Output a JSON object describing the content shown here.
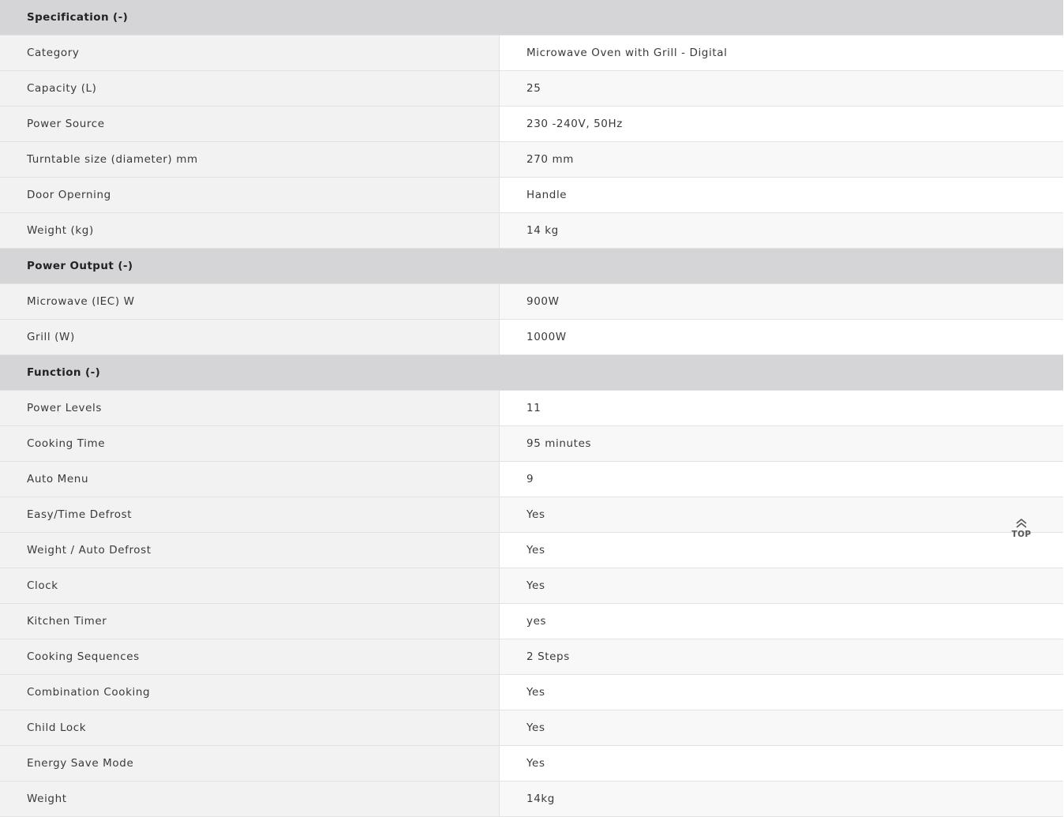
{
  "sections": [
    {
      "title": "Specification (-)",
      "rows": [
        {
          "label": "Category",
          "value": "Microwave Oven with Grill - Digital"
        },
        {
          "label": "Capacity (L)",
          "value": "25"
        },
        {
          "label": "Power Source",
          "value": "230 -240V, 50Hz"
        },
        {
          "label": "Turntable size (diameter) mm",
          "value": "270 mm"
        },
        {
          "label": "Door Operning",
          "value": "Handle"
        },
        {
          "label": "Weight (kg)",
          "value": "14 kg"
        }
      ]
    },
    {
      "title": "Power Output (-)",
      "rows": [
        {
          "label": "Microwave (IEC) W",
          "value": "900W"
        },
        {
          "label": "Grill (W)",
          "value": "1000W"
        }
      ]
    },
    {
      "title": "Function (-)",
      "rows": [
        {
          "label": "Power Levels",
          "value": "11"
        },
        {
          "label": "Cooking Time",
          "value": "95 minutes"
        },
        {
          "label": "Auto Menu",
          "value": "9"
        },
        {
          "label": "Easy/Time Defrost",
          "value": "Yes"
        },
        {
          "label": "Weight / Auto Defrost",
          "value": "Yes"
        },
        {
          "label": "Clock",
          "value": "Yes"
        },
        {
          "label": "Kitchen Timer",
          "value": "yes"
        },
        {
          "label": "Cooking Sequences",
          "value": "2 Steps"
        },
        {
          "label": "Combination Cooking",
          "value": "Yes"
        },
        {
          "label": "Child Lock",
          "value": "Yes"
        },
        {
          "label": "Energy Save Mode",
          "value": "Yes"
        },
        {
          "label": "Weight",
          "value": "14kg"
        }
      ]
    }
  ],
  "scroll_top": {
    "label": "TOP",
    "icon": "double-chevron-up-icon"
  }
}
